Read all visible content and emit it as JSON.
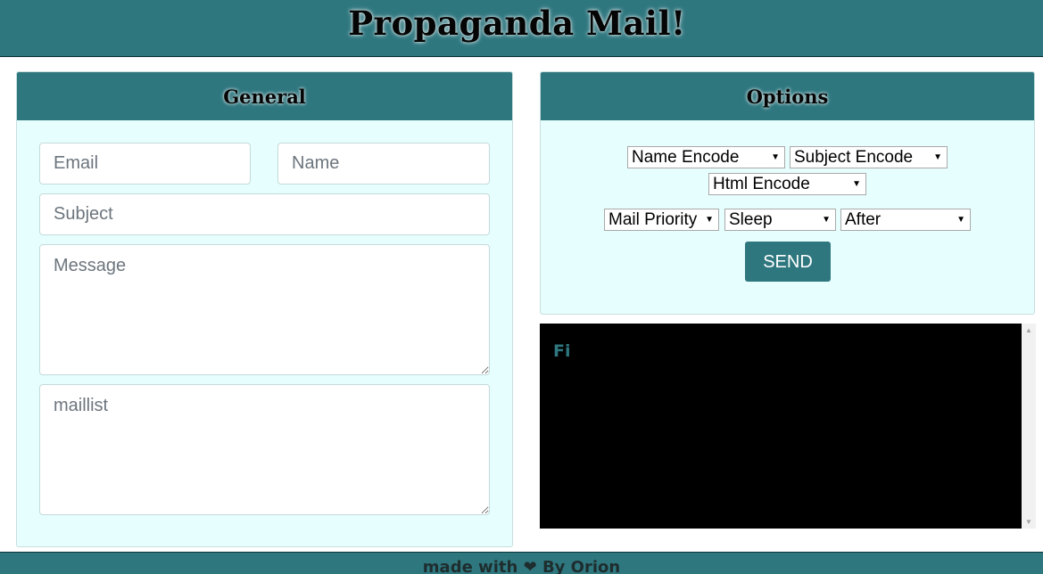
{
  "header": {
    "title": "Propaganda Mail!"
  },
  "general": {
    "title": "General",
    "email_placeholder": "Email",
    "name_placeholder": "Name",
    "subject_placeholder": "Subject",
    "message_placeholder": "Message",
    "maillist_placeholder": "maillist"
  },
  "options": {
    "title": "Options",
    "name_encode": "Name Encode",
    "subject_encode": "Subject Encode",
    "html_encode": "Html Encode",
    "mail_priority": "Mail Priority",
    "sleep": "Sleep",
    "after": "After",
    "send_label": "SEND"
  },
  "console": {
    "text": "Fi"
  },
  "footer": {
    "prefix": "made with",
    "suffix": "By Orion"
  },
  "colors": {
    "accent": "#2f777f",
    "panel_bg": "#e6fefd",
    "console_bg": "#000000"
  }
}
